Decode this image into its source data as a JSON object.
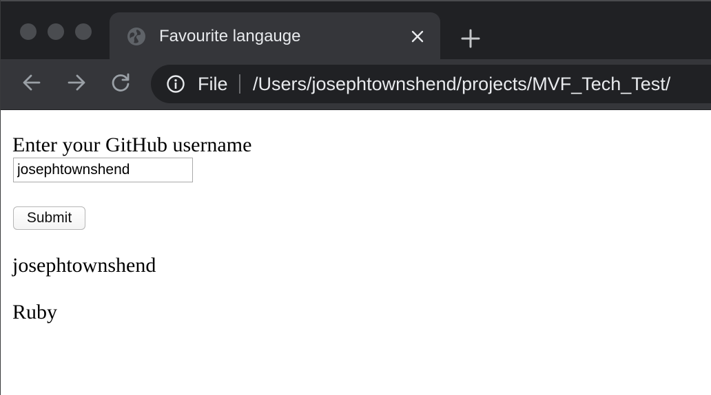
{
  "browser": {
    "tab": {
      "title": "Favourite langauge",
      "favicon": "globe-icon",
      "close_icon": "close-icon"
    },
    "new_tab_icon": "plus-icon",
    "nav": {
      "back_icon": "arrow-left-icon",
      "forward_icon": "arrow-right-icon",
      "reload_icon": "reload-icon"
    },
    "address_bar": {
      "info_icon": "info-icon",
      "scheme_label": "File",
      "url": "/Users/josephtownshend/projects/MVF_Tech_Test/"
    },
    "colors": {
      "tab_strip": "#202124",
      "toolbar": "#35363a",
      "omnibox": "#202124",
      "text": "#e8eaed"
    }
  },
  "form": {
    "label": "Enter your GitHub username",
    "username_value": "josephtownshend",
    "submit_label": "Submit"
  },
  "result": {
    "username": "josephtownshend",
    "language": "Ruby"
  }
}
